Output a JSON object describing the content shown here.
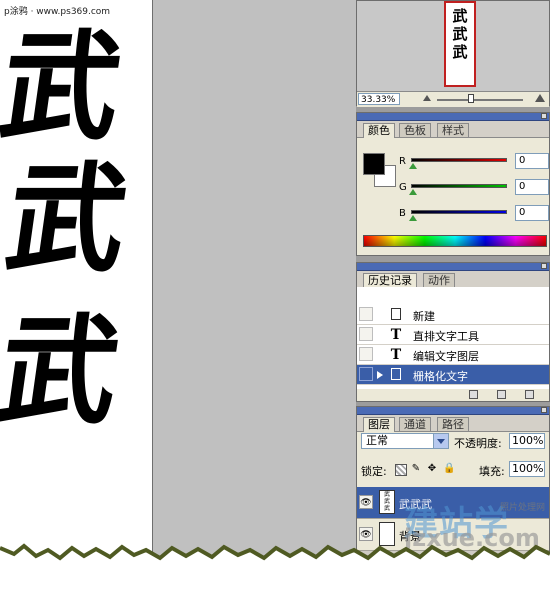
{
  "watermark_top": "p涂鸦 · www.ps369.com",
  "canvas": {
    "glyphs": [
      "武",
      "武",
      "武"
    ]
  },
  "navigator": {
    "thumb_glyphs": [
      "武",
      "武",
      "武"
    ],
    "zoom": "33.33%",
    "zoom_level_fraction": 0.4
  },
  "color": {
    "tabs": [
      "颜色",
      "色板",
      "样式"
    ],
    "channels": [
      {
        "label": "R",
        "value": "0",
        "bar_color": "#c00000"
      },
      {
        "label": "G",
        "value": "0",
        "bar_color": "#00a000"
      },
      {
        "label": "B",
        "value": "0",
        "bar_color": "#0000c0"
      }
    ],
    "foreground": "#000000",
    "background": "#ffffff"
  },
  "history": {
    "tabs": [
      "历史记录",
      "动作"
    ],
    "items": [
      {
        "icon": "new-document-icon",
        "label": "新建"
      },
      {
        "icon": "type-tool-icon",
        "label": "直排文字工具"
      },
      {
        "icon": "type-tool-icon",
        "label": "编辑文字图层"
      },
      {
        "icon": "rasterize-icon",
        "label": "栅格化文字",
        "selected": true
      }
    ]
  },
  "layers": {
    "tabs": [
      "图层",
      "通道",
      "路径"
    ],
    "blend_mode": "正常",
    "opacity_label": "不透明度:",
    "opacity": "100%",
    "lock_label": "锁定:",
    "fill_label": "填充:",
    "fill": "100%",
    "items": [
      {
        "name": "武武武",
        "selected": true
      },
      {
        "name": "背景",
        "selected": false
      }
    ]
  },
  "site_watermark": {
    "big": "建站学",
    "small": "jzxue.com",
    "tiny": "照片处理网"
  },
  "accent": "#3a5ea8"
}
